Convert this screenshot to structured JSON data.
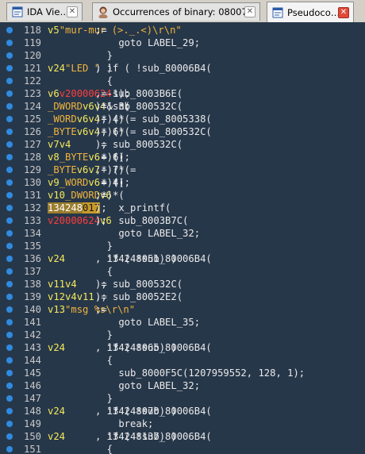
{
  "tabs": [
    {
      "label": "IDA Vie…",
      "icon": "ida-view-icon"
    },
    {
      "label": "Occurrences of binary: 08007…",
      "icon": "occurrences-icon"
    },
    {
      "label": "Pseudoco…",
      "icon": "pseudocode-icon"
    }
  ],
  "lines": [
    {
      "num": "118",
      "tokens": [
        [
          "txt",
          "    "
        ],
        [
          "var",
          "v5"
        ],
        [
          "txt",
          " = "
        ],
        [
          "str",
          "\"mur-mur (>._.<)\\r\\n\""
        ],
        [
          "txt",
          ";"
        ]
      ]
    },
    {
      "num": "119",
      "tokens": [
        [
          "txt",
          "    goto LABEL_29;"
        ]
      ]
    },
    {
      "num": "120",
      "tokens": [
        [
          "txt",
          "  }"
        ]
      ]
    },
    {
      "num": "121",
      "tokens": [
        [
          "txt",
          "  if ( !sub_80006B4("
        ],
        [
          "var",
          "v24"
        ],
        [
          "txt",
          ", "
        ],
        [
          "str",
          "\"LED \""
        ],
        [
          "txt",
          ") )"
        ]
      ]
    },
    {
      "num": "122",
      "tokens": [
        [
          "txt",
          "  {"
        ]
      ]
    },
    {
      "num": "123",
      "tokens": [
        [
          "txt",
          "    "
        ],
        [
          "var",
          "v6"
        ],
        [
          "txt",
          " = sub_8003B6E("
        ],
        [
          "gbl",
          "v20000624"
        ],
        [
          "txt",
          ", -1);"
        ]
      ]
    },
    {
      "num": "124",
      "tokens": [
        [
          "txt",
          "    *("
        ],
        [
          "typ",
          "_DWORD"
        ],
        [
          "txt",
          " *)"
        ],
        [
          "var",
          "v6"
        ],
        [
          "txt",
          " = sub_800532C("
        ],
        [
          "var",
          "v4"
        ],
        [
          "txt",
          ") & 3;"
        ]
      ]
    },
    {
      "num": "125",
      "tokens": [
        [
          "txt",
          "    *("
        ],
        [
          "typ",
          "_WORD"
        ],
        [
          "txt",
          " *)("
        ],
        [
          "var",
          "v6"
        ],
        [
          "txt",
          " + 4) = sub_8005338("
        ],
        [
          "var",
          "v4"
        ],
        [
          "txt",
          ");"
        ]
      ]
    },
    {
      "num": "126",
      "tokens": [
        [
          "txt",
          "    *("
        ],
        [
          "typ",
          "_BYTE"
        ],
        [
          "txt",
          " *)("
        ],
        [
          "var",
          "v6"
        ],
        [
          "txt",
          " + 6) = sub_800532C("
        ],
        [
          "var",
          "v4"
        ],
        [
          "txt",
          ");"
        ]
      ]
    },
    {
      "num": "127",
      "tokens": [
        [
          "txt",
          "    "
        ],
        [
          "var",
          "v7"
        ],
        [
          "txt",
          " = sub_800532C("
        ],
        [
          "var",
          "v4"
        ],
        [
          "txt",
          ");"
        ]
      ]
    },
    {
      "num": "128",
      "tokens": [
        [
          "txt",
          "    "
        ],
        [
          "var",
          "v8"
        ],
        [
          "txt",
          " = *("
        ],
        [
          "typ",
          "_BYTE"
        ],
        [
          "txt",
          " *)("
        ],
        [
          "var",
          "v6"
        ],
        [
          "txt",
          " + 6);"
        ]
      ]
    },
    {
      "num": "129",
      "tokens": [
        [
          "txt",
          "    *("
        ],
        [
          "typ",
          "_BYTE"
        ],
        [
          "txt",
          " *)("
        ],
        [
          "var",
          "v6"
        ],
        [
          "txt",
          " + 7) = "
        ],
        [
          "var",
          "v7"
        ],
        [
          "txt",
          ";"
        ]
      ]
    },
    {
      "num": "130",
      "tokens": [
        [
          "txt",
          "    "
        ],
        [
          "var",
          "v9"
        ],
        [
          "txt",
          " = *("
        ],
        [
          "typ",
          "_WORD"
        ],
        [
          "txt",
          " *)("
        ],
        [
          "var",
          "v6"
        ],
        [
          "txt",
          " + 4);"
        ]
      ]
    },
    {
      "num": "131",
      "tokens": [
        [
          "txt",
          "    "
        ],
        [
          "var",
          "v10"
        ],
        [
          "txt",
          " = *("
        ],
        [
          "typ",
          "_DWORD"
        ],
        [
          "txt",
          " *)"
        ],
        [
          "var",
          "v6"
        ],
        [
          "txt",
          ";"
        ]
      ]
    },
    {
      "num": "132",
      "tokens": [
        [
          "txt",
          "    x_printf("
        ],
        [
          "hl2",
          "134248"
        ],
        [
          "hl",
          "017"
        ],
        [
          "txt",
          ");"
        ]
      ]
    },
    {
      "num": "133",
      "tokens": [
        [
          "txt",
          "    sub_8003B7C("
        ],
        [
          "gbl",
          "v20000624"
        ],
        [
          "txt",
          ", "
        ],
        [
          "var",
          "v6"
        ],
        [
          "txt",
          ");"
        ]
      ]
    },
    {
      "num": "134",
      "tokens": [
        [
          "txt",
          "    goto LABEL_32;"
        ]
      ]
    },
    {
      "num": "135",
      "tokens": [
        [
          "txt",
          "  }"
        ]
      ]
    },
    {
      "num": "136",
      "tokens": [
        [
          "txt",
          "  if ( !sub_80006B4("
        ],
        [
          "var",
          "v24"
        ],
        [
          "txt",
          ", 134248051) )"
        ]
      ]
    },
    {
      "num": "137",
      "tokens": [
        [
          "txt",
          "  {"
        ]
      ]
    },
    {
      "num": "138",
      "tokens": [
        [
          "txt",
          "    "
        ],
        [
          "var",
          "v11"
        ],
        [
          "txt",
          " = sub_800532C("
        ],
        [
          "var",
          "v4"
        ],
        [
          "txt",
          ");"
        ]
      ]
    },
    {
      "num": "139",
      "tokens": [
        [
          "txt",
          "    "
        ],
        [
          "var",
          "v12"
        ],
        [
          "txt",
          " = sub_80052E2("
        ],
        [
          "var",
          "v4"
        ],
        [
          "txt",
          ", "
        ],
        [
          "var",
          "v11"
        ],
        [
          "txt",
          ");"
        ]
      ]
    },
    {
      "num": "140",
      "tokens": [
        [
          "txt",
          "    "
        ],
        [
          "var",
          "v13"
        ],
        [
          "txt",
          " = "
        ],
        [
          "str",
          "\"msg %s\\r\\n\""
        ],
        [
          "txt",
          ";"
        ]
      ]
    },
    {
      "num": "141",
      "tokens": [
        [
          "txt",
          "    goto LABEL_35;"
        ]
      ]
    },
    {
      "num": "142",
      "tokens": [
        [
          "txt",
          "  }"
        ]
      ]
    },
    {
      "num": "143",
      "tokens": [
        [
          "txt",
          "  if ( !sub_80006B4("
        ],
        [
          "var",
          "v24"
        ],
        [
          "txt",
          ", 134248065) )"
        ]
      ]
    },
    {
      "num": "144",
      "tokens": [
        [
          "txt",
          "  {"
        ]
      ]
    },
    {
      "num": "145",
      "tokens": [
        [
          "txt",
          "    sub_8000F5C(1207959552, 128, 1);"
        ]
      ]
    },
    {
      "num": "146",
      "tokens": [
        [
          "txt",
          "    goto LABEL_32;"
        ]
      ]
    },
    {
      "num": "147",
      "tokens": [
        [
          "txt",
          "  }"
        ]
      ]
    },
    {
      "num": "148",
      "tokens": [
        [
          "txt",
          "  if ( !sub_80006B4("
        ],
        [
          "var",
          "v24"
        ],
        [
          "txt",
          ", 134248070) )"
        ]
      ]
    },
    {
      "num": "149",
      "tokens": [
        [
          "txt",
          "    break;"
        ]
      ]
    },
    {
      "num": "150",
      "tokens": [
        [
          "txt",
          "  if ( !sub_80006B4("
        ],
        [
          "var",
          "v24"
        ],
        [
          "txt",
          ", 134248137) )"
        ]
      ]
    },
    {
      "num": "151",
      "tokens": [
        [
          "txt",
          "  {"
        ]
      ]
    }
  ]
}
